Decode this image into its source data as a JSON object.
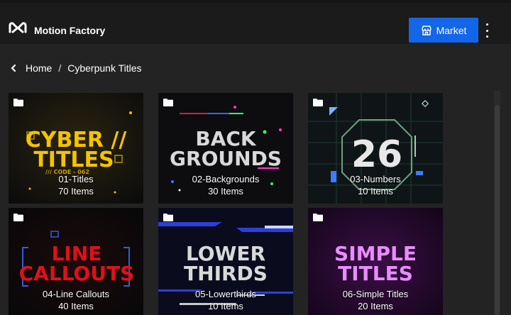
{
  "app": {
    "title": "Motion Factory",
    "market_label": "Market"
  },
  "breadcrumb": {
    "home": "Home",
    "separator": "/",
    "current": "Cyberpunk Titles"
  },
  "folders": [
    {
      "name": "01-Titles",
      "count": "70 Items",
      "art_lines": [
        "CYBER //",
        "TITLES",
        "/// CODE - 062"
      ],
      "accent": "#f5c300"
    },
    {
      "name": "02-Backgrounds",
      "count": "30 Items",
      "art_lines": [
        "BACK",
        "GROUNDS"
      ],
      "accent": "#d9d9d9"
    },
    {
      "name": "03-Numbers",
      "count": "10 Items",
      "art_lines": [
        "26"
      ],
      "accent": "#e8e8e8"
    },
    {
      "name": "04-Line Callouts",
      "count": "40 Items",
      "art_lines": [
        "LINE",
        "CALLOUTS"
      ],
      "accent": "#e0101a"
    },
    {
      "name": "05-Lowerthirds",
      "count": "10 Items",
      "art_lines": [
        "LOWER",
        "THIRDS"
      ],
      "accent": "#d9d9d9"
    },
    {
      "name": "06-Simple Titles",
      "count": "20 Items",
      "art_lines": [
        "SIMPLE",
        "TITLES"
      ],
      "accent": "#e98cff"
    }
  ],
  "colors": {
    "header_bg": "#1b1b1b",
    "page_bg": "#232323",
    "market_button": "#1466e8"
  },
  "icons": {
    "logo": "motion-factory-logo",
    "market": "storefront-icon",
    "menu": "kebab-menu-icon",
    "back": "chevron-left-icon",
    "folder": "folder-icon"
  }
}
